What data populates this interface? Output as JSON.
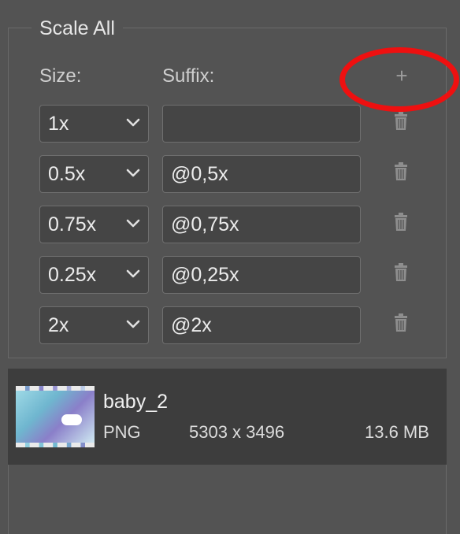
{
  "panel": {
    "title": "Scale All",
    "size_label": "Size:",
    "suffix_label": "Suffix:",
    "add_symbol": "+"
  },
  "scales": [
    {
      "size": "1x",
      "suffix": ""
    },
    {
      "size": "0.5x",
      "suffix": "@0,5x"
    },
    {
      "size": "0.75x",
      "suffix": "@0,75x"
    },
    {
      "size": "0.25x",
      "suffix": "@0,25x"
    },
    {
      "size": "2x",
      "suffix": "@2x"
    }
  ],
  "asset": {
    "name": "baby_2",
    "format": "PNG",
    "dimensions": "5303 x 3496",
    "file_size": "13.6 MB"
  },
  "colors": {
    "highlight_ring": "#ee1010",
    "panel_bg": "#535353",
    "field_bg": "#454545",
    "card_bg": "#3d3d3d"
  }
}
